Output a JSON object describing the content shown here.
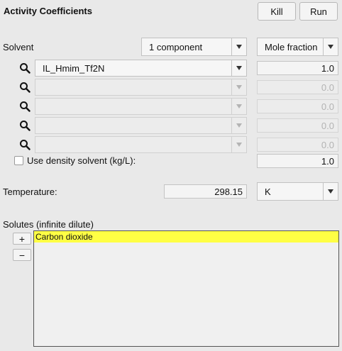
{
  "header": {
    "title": "Activity Coefficients",
    "kill_label": "Kill",
    "run_label": "Run"
  },
  "solvent": {
    "label": "Solvent",
    "components_select": "1 component",
    "fraction_select": "Mole fraction",
    "rows": [
      {
        "name": "IL_Hmim_Tf2N",
        "value": "1.0"
      },
      {
        "name": "",
        "value": "0.0"
      },
      {
        "name": "",
        "value": "0.0"
      },
      {
        "name": "",
        "value": "0.0"
      },
      {
        "name": "",
        "value": "0.0"
      }
    ],
    "density_label": "Use density solvent (kg/L):",
    "density_value": "1.0"
  },
  "temperature": {
    "label": "Temperature:",
    "value": "298.15",
    "unit": "K"
  },
  "solutes": {
    "label": "Solutes (infinite dilute)",
    "add_label": "+",
    "remove_label": "−",
    "items": [
      "Carbon dioxide"
    ]
  },
  "icons": {
    "search": "magnifier-icon",
    "dropdown": "chevron-down-icon"
  }
}
